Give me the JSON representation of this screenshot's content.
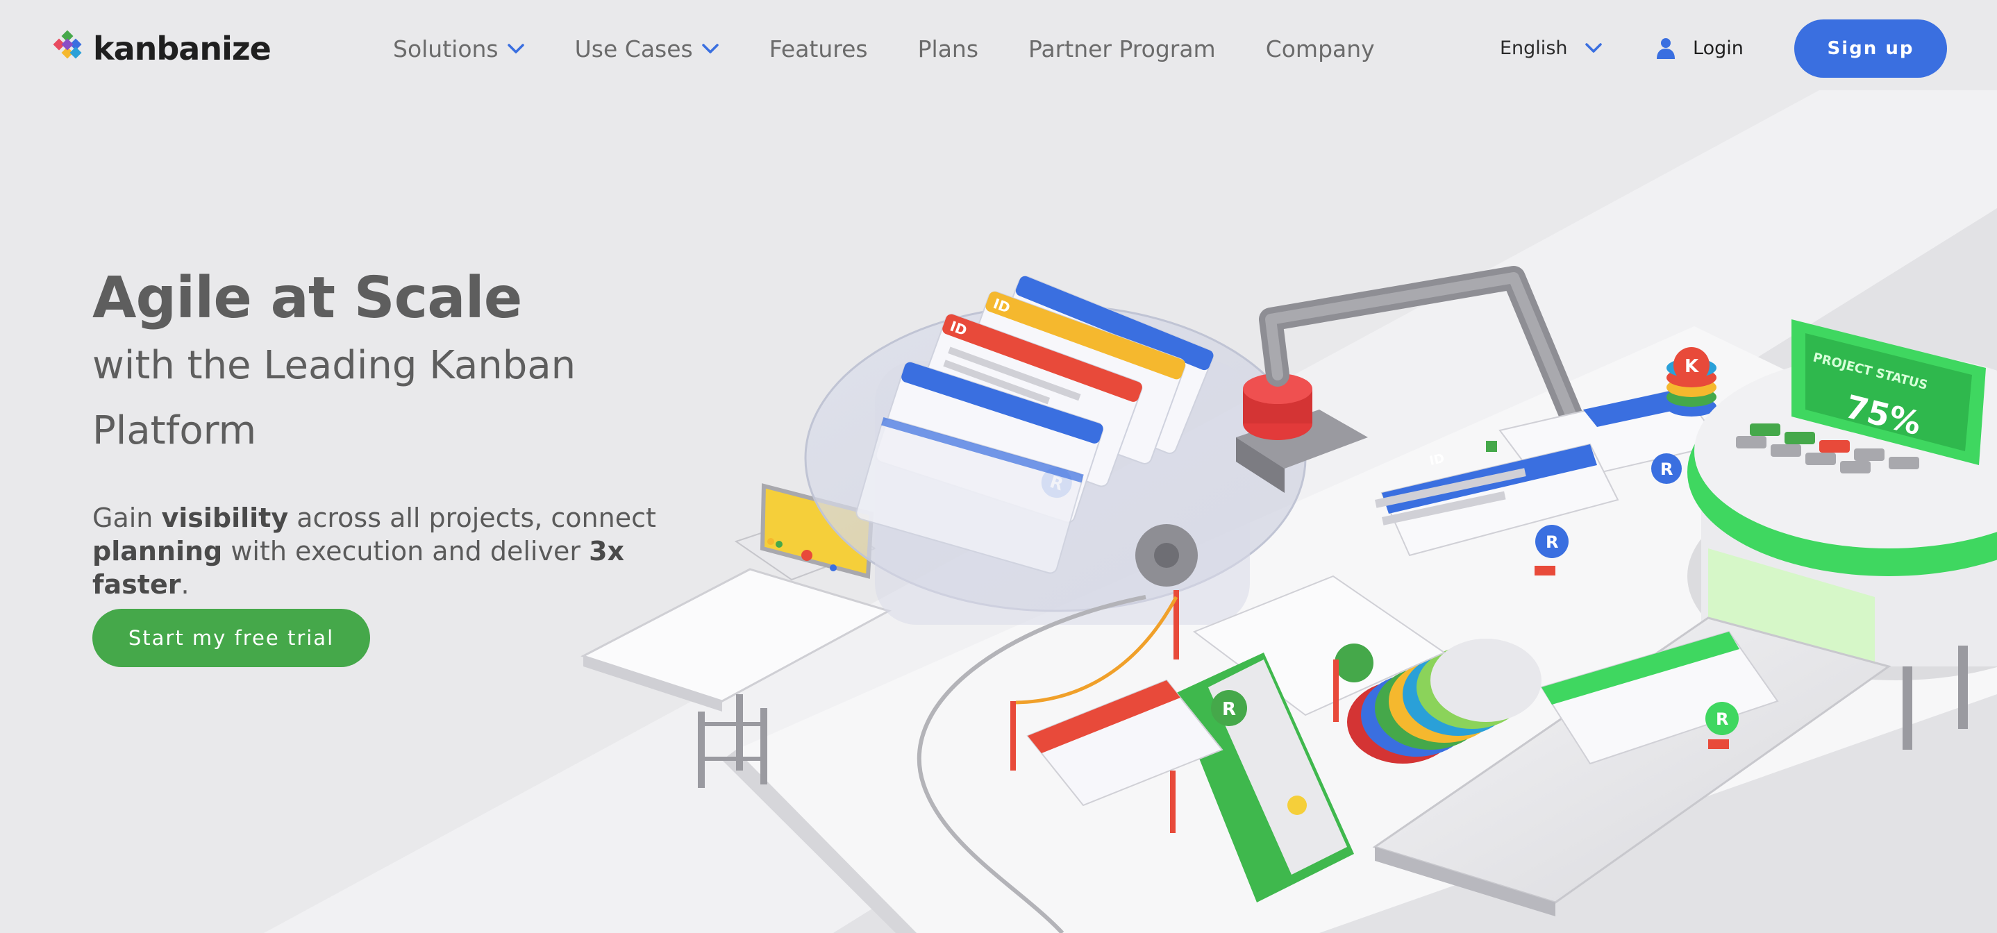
{
  "header": {
    "logo_text": "kanbanize",
    "nav": [
      {
        "label": "Solutions",
        "dropdown": true
      },
      {
        "label": "Use Cases",
        "dropdown": true
      },
      {
        "label": "Features",
        "dropdown": false
      },
      {
        "label": "Plans",
        "dropdown": false
      },
      {
        "label": "Partner Program",
        "dropdown": false
      },
      {
        "label": "Company",
        "dropdown": false
      }
    ],
    "language": "English",
    "login_label": "Login",
    "signup_label": "Sign up"
  },
  "hero": {
    "title": "Agile at Scale",
    "subtitle": "with the Leading Kanban Platform",
    "desc_parts": {
      "p1": "Gain ",
      "b1": "visibility",
      "p2": " across all projects, connect ",
      "b2": "planning",
      "p3": " with execution and deliver ",
      "b3": "3x faster",
      "p4": "."
    },
    "cta_label": "Start my free trial"
  },
  "illustration": {
    "status_title": "PROJECT STATUS",
    "status_value": "75%",
    "card_id_label": "ID",
    "card_avatar_letter": "R",
    "token_letter": "K"
  },
  "colors": {
    "accent_blue": "#3a6fe0",
    "accent_green": "#45a84a",
    "text_gray": "#5e5e5e",
    "background": "#e9e9eb"
  }
}
